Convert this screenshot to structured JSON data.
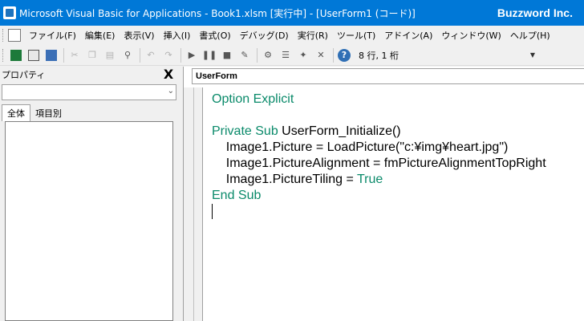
{
  "titlebar": {
    "title": "Microsoft Visual Basic for Applications - Book1.xlsm [実行中] - [UserForm1 (コード)]",
    "brand": "Buzzword Inc."
  },
  "menu": {
    "items": [
      "ファイル(F)",
      "編集(E)",
      "表示(V)",
      "挿入(I)",
      "書式(O)",
      "デバッグ(D)",
      "実行(R)",
      "ツール(T)",
      "アドイン(A)",
      "ウィンドウ(W)",
      "ヘルプ(H)"
    ]
  },
  "toolbar": {
    "position": "8 行, 1 桁"
  },
  "properties": {
    "title": "プロパティ",
    "close": "X",
    "tabs": [
      "全体",
      "項目別"
    ]
  },
  "code": {
    "object": "UserForm",
    "lines": [
      [
        {
          "t": "Option Explicit",
          "k": true
        }
      ],
      [],
      [
        {
          "t": "Private Sub ",
          "k": true
        },
        {
          "t": "UserForm_Initialize()",
          "k": false
        }
      ],
      [
        {
          "t": "    Image1.Picture = LoadPicture(\"c:¥img¥heart.jpg\")",
          "k": false
        }
      ],
      [
        {
          "t": "    Image1.PictureAlignment = fmPictureAlignmentTopRight",
          "k": false
        }
      ],
      [
        {
          "t": "    Image1.PictureTiling = ",
          "k": false
        },
        {
          "t": "True",
          "k": true
        }
      ],
      [
        {
          "t": "End Sub",
          "k": true
        }
      ]
    ]
  }
}
